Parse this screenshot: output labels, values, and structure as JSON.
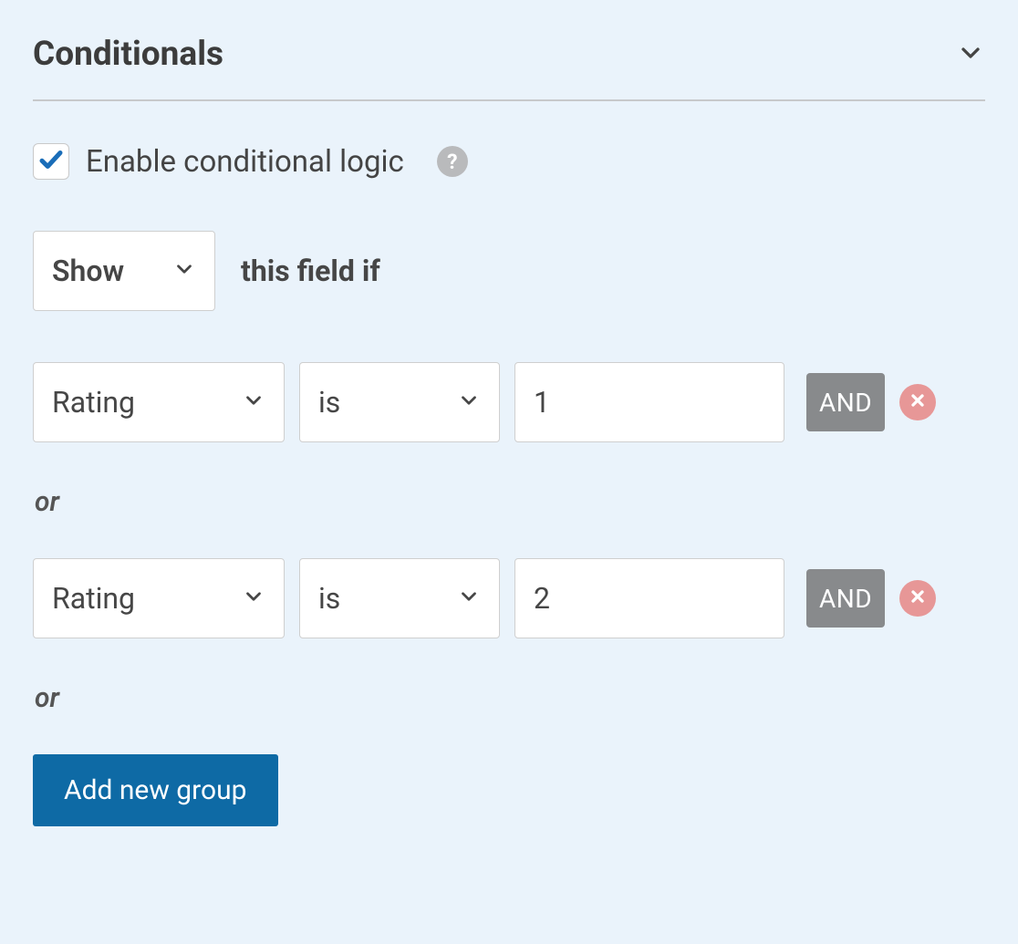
{
  "section": {
    "title": "Conditionals"
  },
  "enable": {
    "checked": true,
    "label": "Enable conditional logic",
    "help_glyph": "?"
  },
  "action": {
    "value": "Show",
    "suffix": "this field if"
  },
  "or_label": "or",
  "and_label": "AND",
  "rules": [
    {
      "field": "Rating",
      "op": "is",
      "value": "1"
    },
    {
      "field": "Rating",
      "op": "is",
      "value": "2"
    }
  ],
  "add_group_label": "Add new group"
}
